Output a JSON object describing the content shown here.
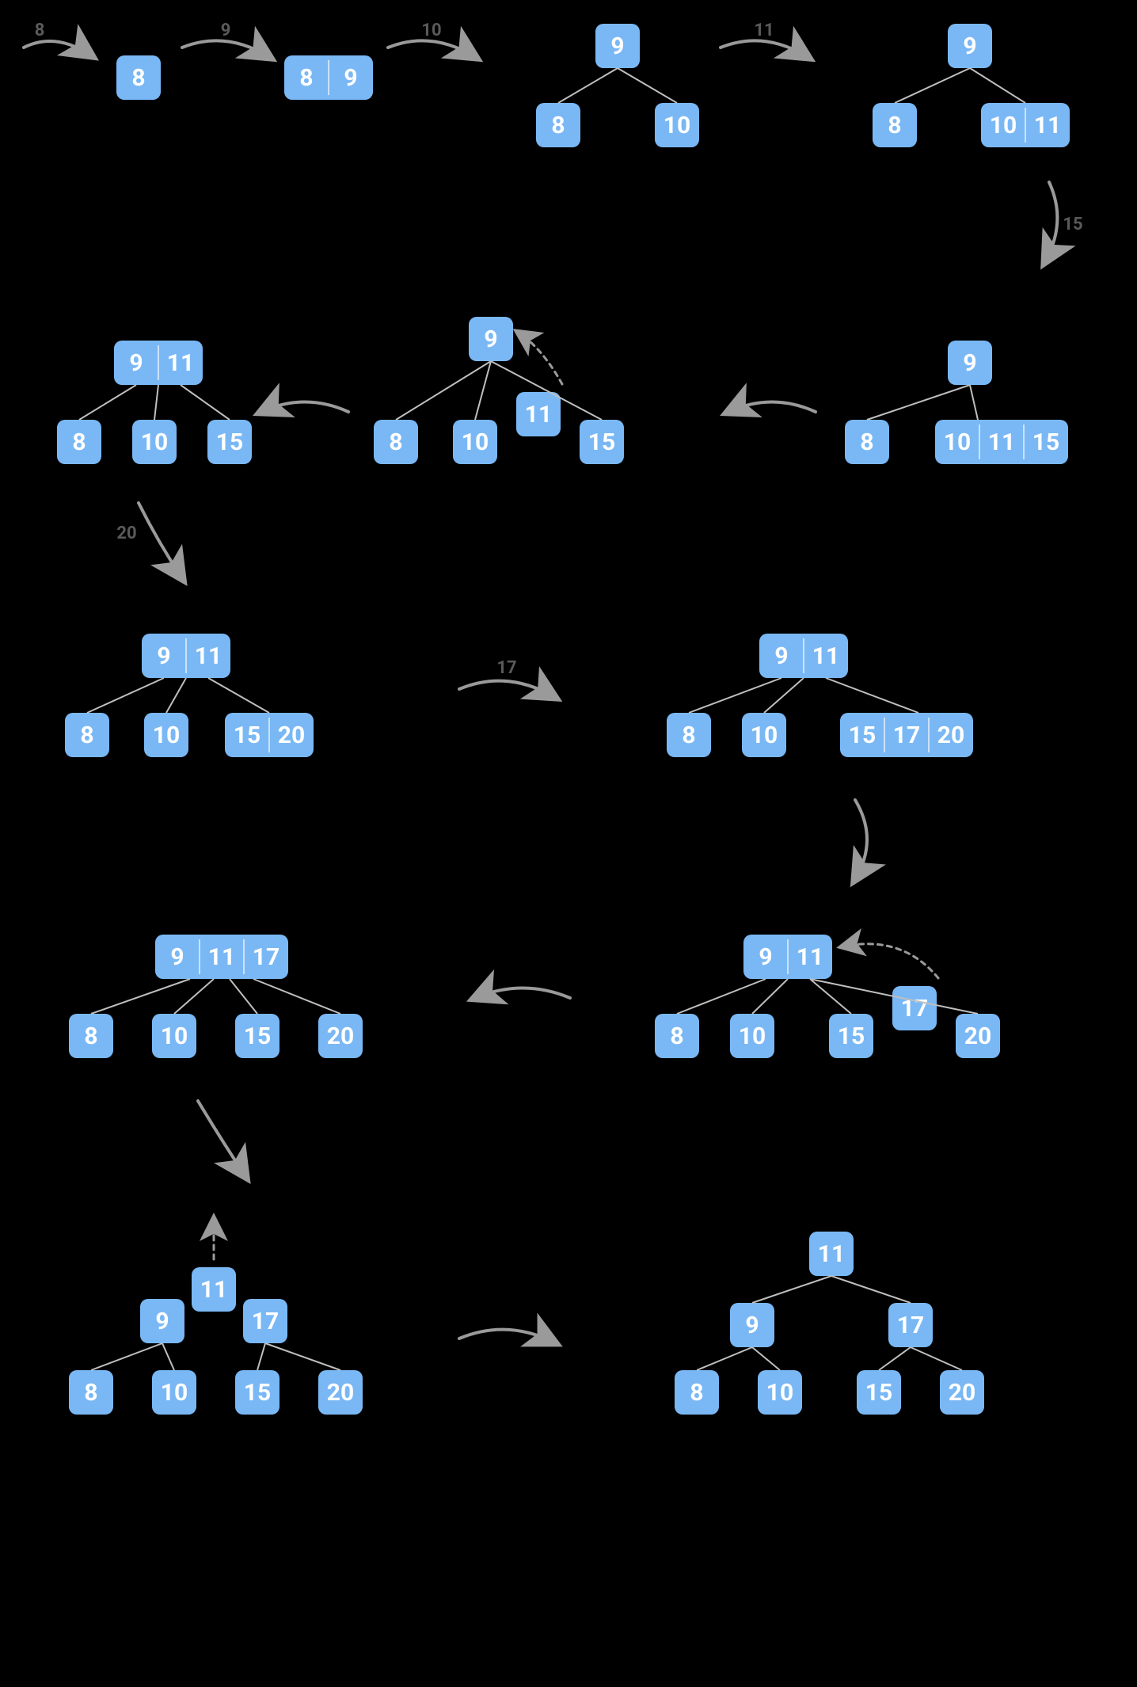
{
  "colors": {
    "node": "#7ab8f5",
    "bg": "#000000",
    "arrow": "#9a9a9a",
    "edge": "#bfbfbf",
    "label": "#5a5a5a"
  },
  "insertSequence": [
    8,
    9,
    10,
    11,
    15,
    20,
    17
  ],
  "transitions": [
    {
      "label": "8"
    },
    {
      "label": "9"
    },
    {
      "label": "10"
    },
    {
      "label": "11"
    },
    {
      "label": "15"
    },
    {
      "label": ""
    },
    {
      "label": ""
    },
    {
      "label": "20"
    },
    {
      "label": "17"
    },
    {
      "label": ""
    },
    {
      "label": ""
    },
    {
      "label": ""
    },
    {
      "label": ""
    }
  ],
  "steps": [
    {
      "id": "s1",
      "tree": {
        "root": {
          "keys": [
            8
          ]
        }
      }
    },
    {
      "id": "s2",
      "tree": {
        "root": {
          "keys": [
            8,
            9
          ]
        }
      }
    },
    {
      "id": "s3",
      "tree": {
        "root": {
          "keys": [
            9
          ],
          "children": [
            {
              "keys": [
                8
              ]
            },
            {
              "keys": [
                10
              ]
            }
          ]
        }
      }
    },
    {
      "id": "s4",
      "tree": {
        "root": {
          "keys": [
            9
          ],
          "children": [
            {
              "keys": [
                8
              ]
            },
            {
              "keys": [
                10,
                11
              ]
            }
          ]
        }
      }
    },
    {
      "id": "s5",
      "tree": {
        "root": {
          "keys": [
            9
          ],
          "children": [
            {
              "keys": [
                8
              ]
            },
            {
              "keys": [
                10,
                11,
                15
              ]
            }
          ]
        }
      },
      "note": "overflow"
    },
    {
      "id": "s6",
      "tree": {
        "root": {
          "keys": [
            9
          ],
          "children": [
            {
              "keys": [
                8
              ]
            },
            {
              "keys": [
                10
              ]
            },
            {
              "keys": [
                15
              ]
            }
          ]
        },
        "promoting": 11
      },
      "note": "split-promote"
    },
    {
      "id": "s7",
      "tree": {
        "root": {
          "keys": [
            9,
            11
          ],
          "children": [
            {
              "keys": [
                8
              ]
            },
            {
              "keys": [
                10
              ]
            },
            {
              "keys": [
                15
              ]
            }
          ]
        }
      }
    },
    {
      "id": "s8",
      "tree": {
        "root": {
          "keys": [
            9,
            11
          ],
          "children": [
            {
              "keys": [
                8
              ]
            },
            {
              "keys": [
                10
              ]
            },
            {
              "keys": [
                15,
                20
              ]
            }
          ]
        }
      }
    },
    {
      "id": "s9",
      "tree": {
        "root": {
          "keys": [
            9,
            11
          ],
          "children": [
            {
              "keys": [
                8
              ]
            },
            {
              "keys": [
                10
              ]
            },
            {
              "keys": [
                15,
                17,
                20
              ]
            }
          ]
        }
      },
      "note": "overflow"
    },
    {
      "id": "s10",
      "tree": {
        "root": {
          "keys": [
            9,
            11
          ],
          "children": [
            {
              "keys": [
                8
              ]
            },
            {
              "keys": [
                10
              ]
            },
            {
              "keys": [
                15
              ]
            },
            {
              "keys": [
                20
              ]
            }
          ]
        },
        "promoting": 17
      },
      "note": "split-promote"
    },
    {
      "id": "s11",
      "tree": {
        "root": {
          "keys": [
            9,
            11,
            17
          ],
          "children": [
            {
              "keys": [
                8
              ]
            },
            {
              "keys": [
                10
              ]
            },
            {
              "keys": [
                15
              ]
            },
            {
              "keys": [
                20
              ]
            }
          ]
        }
      },
      "note": "overflow"
    },
    {
      "id": "s12",
      "tree": {
        "root": {
          "keys": [
            9,
            17
          ],
          "children": [
            {
              "keys": [
                8
              ]
            },
            {
              "keys": [
                10
              ]
            },
            {
              "keys": [
                15
              ]
            },
            {
              "keys": [
                20
              ]
            }
          ]
        },
        "promoting": 11
      },
      "note": "split-promote-root"
    },
    {
      "id": "s13",
      "tree": {
        "root": {
          "keys": [
            11
          ],
          "children": [
            {
              "keys": [
                9
              ],
              "children": [
                {
                  "keys": [
                    8
                  ]
                },
                {
                  "keys": [
                    10
                  ]
                }
              ]
            },
            {
              "keys": [
                17
              ],
              "children": [
                {
                  "keys": [
                    15
                  ]
                },
                {
                  "keys": [
                    20
                  ]
                }
              ]
            }
          ]
        }
      }
    }
  ]
}
